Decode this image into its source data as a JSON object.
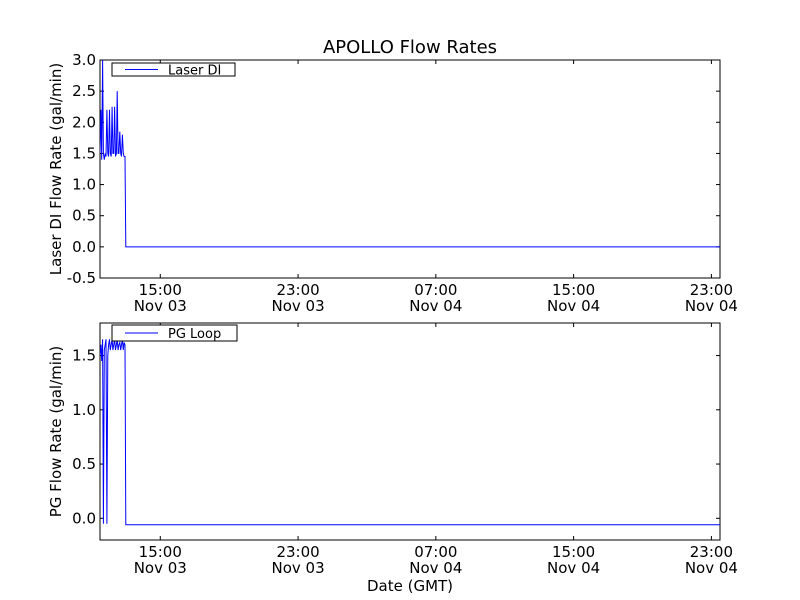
{
  "chart_data": [
    {
      "type": "line",
      "title": "APOLLO Flow Rates",
      "xlabel": "",
      "ylabel": "Laser DI Flow Rate (gal/min)",
      "x_ticks": [
        {
          "time": "15:00",
          "date": "Nov 03"
        },
        {
          "time": "23:00",
          "date": "Nov 03"
        },
        {
          "time": "07:00",
          "date": "Nov 04"
        },
        {
          "time": "15:00",
          "date": "Nov 04"
        },
        {
          "time": "23:00",
          "date": "Nov 04"
        }
      ],
      "y_ticks": [
        "-0.5",
        "0.0",
        "0.5",
        "1.0",
        "1.5",
        "2.0",
        "2.5",
        "3.0"
      ],
      "ylim": [
        -0.5,
        3.0
      ],
      "xlim": [
        "2014-11-03T11:30",
        "2014-11-04T23:30"
      ],
      "legend": {
        "position": "top-left"
      },
      "grid": false,
      "series": [
        {
          "name": "Laser DI",
          "color": "#0000ff",
          "x": [
            "2014-11-03T11:30",
            "2014-11-03T11:33",
            "2014-11-03T11:36",
            "2014-11-03T11:39",
            "2014-11-03T11:42",
            "2014-11-03T11:45",
            "2014-11-03T11:48",
            "2014-11-03T11:51",
            "2014-11-03T11:54",
            "2014-11-03T11:57",
            "2014-11-03T12:00",
            "2014-11-03T12:03",
            "2014-11-03T12:06",
            "2014-11-03T12:09",
            "2014-11-03T12:12",
            "2014-11-03T12:15",
            "2014-11-03T12:18",
            "2014-11-03T12:21",
            "2014-11-03T12:24",
            "2014-11-03T12:27",
            "2014-11-03T12:30",
            "2014-11-03T12:33",
            "2014-11-03T12:36",
            "2014-11-03T12:39",
            "2014-11-03T12:42",
            "2014-11-03T12:45",
            "2014-11-03T12:48",
            "2014-11-03T12:51",
            "2014-11-03T12:54",
            "2014-11-03T12:57",
            "2014-11-03T13:00",
            "2014-11-03T13:03",
            "2014-11-03T13:06",
            "2014-11-03T13:09",
            "2014-11-03T13:12",
            "2014-11-03T13:15",
            "2014-11-03T13:18",
            "2014-11-03T14:00",
            "2014-11-03T16:00",
            "2014-11-03T20:00",
            "2014-11-04T00:00",
            "2014-11-04T04:00",
            "2014-11-04T08:00",
            "2014-11-04T12:00",
            "2014-11-04T16:00",
            "2014-11-04T20:00",
            "2014-11-04T23:30"
          ],
          "y": [
            1.5,
            2.2,
            1.4,
            3.0,
            1.5,
            1.4,
            1.5,
            1.45,
            2.2,
            1.5,
            1.45,
            2.2,
            1.5,
            1.45,
            2.25,
            1.5,
            1.5,
            2.25,
            1.45,
            1.5,
            2.5,
            1.5,
            1.5,
            1.85,
            1.5,
            1.45,
            1.8,
            1.5,
            1.45,
            1.45,
            0.0,
            0.0,
            0.0,
            0.0,
            0.0,
            0.0,
            0.0,
            0.0,
            0.0,
            0.0,
            0.0,
            0.0,
            0.0,
            0.0,
            0.0,
            0.0,
            0.0
          ]
        }
      ]
    },
    {
      "type": "line",
      "title": "",
      "xlabel": "Date (GMT)",
      "ylabel": "PG Flow Rate (gal/min)",
      "x_ticks": [
        {
          "time": "15:00",
          "date": "Nov 03"
        },
        {
          "time": "23:00",
          "date": "Nov 03"
        },
        {
          "time": "07:00",
          "date": "Nov 04"
        },
        {
          "time": "15:00",
          "date": "Nov 04"
        },
        {
          "time": "23:00",
          "date": "Nov 04"
        }
      ],
      "y_ticks": [
        "0.0",
        "0.5",
        "1.0",
        "1.5"
      ],
      "ylim": [
        -0.2,
        1.8
      ],
      "xlim": [
        "2014-11-03T11:30",
        "2014-11-04T23:30"
      ],
      "legend": {
        "position": "top-left"
      },
      "grid": false,
      "series": [
        {
          "name": "PG Loop",
          "color": "#0000ff",
          "x": [
            "2014-11-03T11:30",
            "2014-11-03T11:33",
            "2014-11-03T11:36",
            "2014-11-03T11:39",
            "2014-11-03T11:42",
            "2014-11-03T11:45",
            "2014-11-03T11:48",
            "2014-11-03T11:51",
            "2014-11-03T11:54",
            "2014-11-03T11:57",
            "2014-11-03T12:00",
            "2014-11-03T12:03",
            "2014-11-03T12:06",
            "2014-11-03T12:09",
            "2014-11-03T12:12",
            "2014-11-03T12:15",
            "2014-11-03T12:18",
            "2014-11-03T12:21",
            "2014-11-03T12:24",
            "2014-11-03T12:27",
            "2014-11-03T12:30",
            "2014-11-03T12:33",
            "2014-11-03T12:36",
            "2014-11-03T12:39",
            "2014-11-03T12:42",
            "2014-11-03T12:45",
            "2014-11-03T12:48",
            "2014-11-03T12:51",
            "2014-11-03T12:54",
            "2014-11-03T12:57",
            "2014-11-03T13:00",
            "2014-11-03T13:03",
            "2014-11-03T13:06",
            "2014-11-03T13:09",
            "2014-11-03T13:12",
            "2014-11-03T13:15",
            "2014-11-03T13:18",
            "2014-11-03T14:00",
            "2014-11-03T16:00",
            "2014-11-03T20:00",
            "2014-11-04T00:00",
            "2014-11-04T04:00",
            "2014-11-04T08:00",
            "2014-11-04T12:00",
            "2014-11-04T16:00",
            "2014-11-04T20:00",
            "2014-11-04T23:30"
          ],
          "y": [
            1.5,
            1.6,
            1.45,
            1.65,
            -0.05,
            1.55,
            1.6,
            1.65,
            -0.05,
            1.5,
            1.6,
            1.65,
            1.55,
            1.6,
            1.65,
            1.55,
            1.6,
            1.65,
            1.55,
            1.6,
            1.65,
            1.55,
            1.6,
            1.62,
            1.55,
            1.6,
            1.65,
            1.55,
            1.62,
            1.6,
            -0.06,
            -0.06,
            -0.06,
            -0.06,
            -0.06,
            -0.06,
            -0.06,
            -0.06,
            -0.06,
            -0.06,
            -0.06,
            -0.06,
            -0.06,
            -0.06,
            -0.06,
            -0.06,
            -0.06
          ]
        }
      ]
    }
  ]
}
